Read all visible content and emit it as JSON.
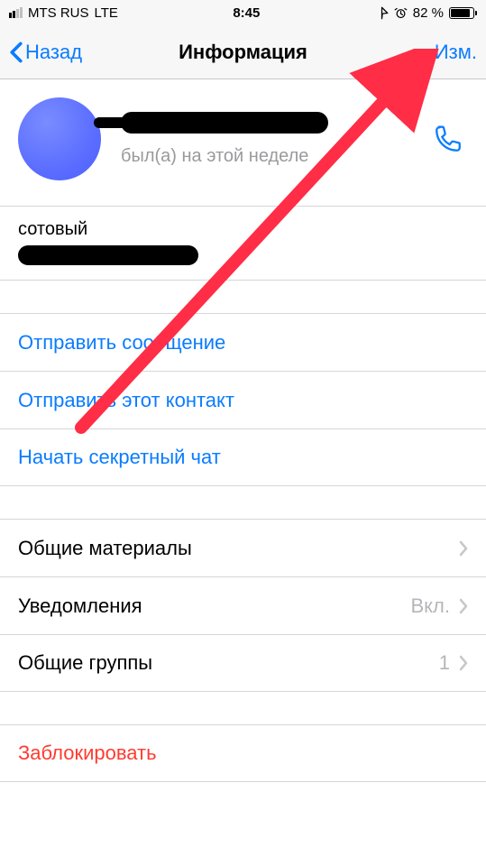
{
  "status": {
    "carrier": "MTS RUS",
    "network": "LTE",
    "time": "8:45",
    "battery_pct": "82 %"
  },
  "nav": {
    "back": "Назад",
    "title": "Информация",
    "edit": "Изм."
  },
  "profile": {
    "last_seen": "был(а) на этой неделе"
  },
  "phone": {
    "label": "сотовый"
  },
  "actions": {
    "send_message": "Отправить сообщение",
    "share_contact": "Отправить этот контакт",
    "secret_chat": "Начать секретный чат"
  },
  "rows": {
    "shared_media": "Общие материалы",
    "notifications": {
      "label": "Уведомления",
      "value": "Вкл."
    },
    "groups": {
      "label": "Общие группы",
      "value": "1"
    },
    "block": "Заблокировать"
  }
}
